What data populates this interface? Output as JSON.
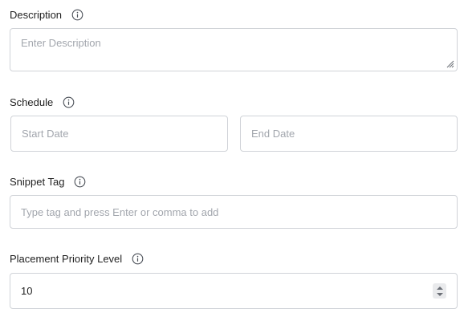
{
  "description": {
    "label": "Description",
    "placeholder": "Enter Description",
    "info_icon": "info-icon"
  },
  "schedule": {
    "label": "Schedule",
    "start_placeholder": "Start Date",
    "end_placeholder": "End Date",
    "info_icon": "info-icon"
  },
  "snippet_tag": {
    "label": "Snippet Tag",
    "placeholder": "Type tag and press Enter or comma to add",
    "info_icon": "info-icon"
  },
  "priority": {
    "label": "Placement Priority Level",
    "value": "10",
    "info_icon": "info-icon"
  }
}
